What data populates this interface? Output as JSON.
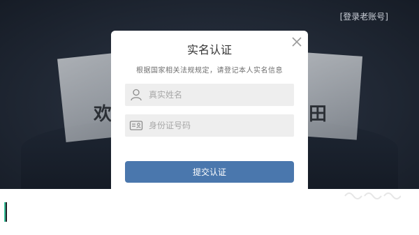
{
  "header": {
    "login_old_account": "[登录老账号]"
  },
  "background": {
    "glyph_left": "欢",
    "glyph_right": "田"
  },
  "dialog": {
    "title": "实名认证",
    "subtitle": "根据国家相关法规规定，请登记本人实名信息",
    "close_icon": "close-icon",
    "fields": [
      {
        "icon": "user-icon",
        "placeholder": "真实姓名",
        "value": ""
      },
      {
        "icon": "id-card-icon",
        "placeholder": "身份证号码",
        "value": ""
      }
    ],
    "submit_label": "提交认证"
  },
  "colors": {
    "submit_button": "#4a77ad",
    "field_bg": "#eeeeee",
    "dialog_bg": "#ffffff",
    "background_dark": "#161c26"
  }
}
